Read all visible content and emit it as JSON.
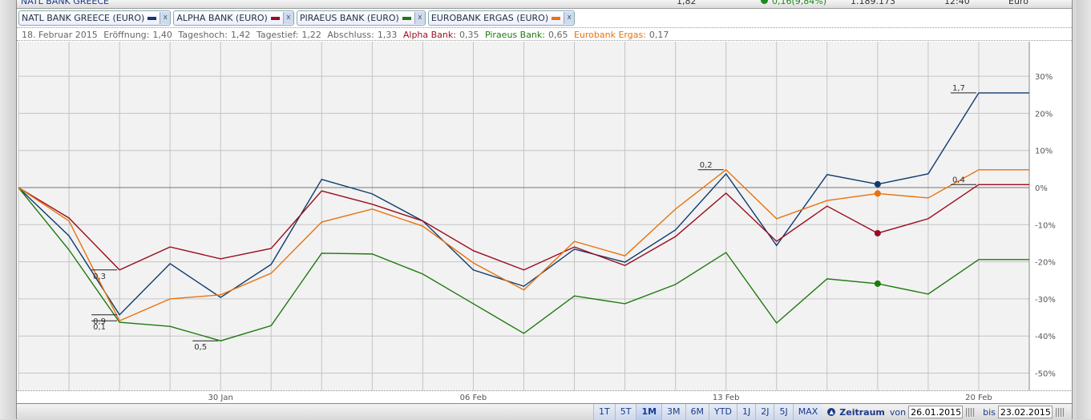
{
  "header": {
    "name": "NATL BANK GREECE",
    "price": "1,82",
    "change": "0,16(9,84%)",
    "volume": "1.189.173",
    "time": "12:40",
    "currency": "Euro",
    "change_color": "#1a8a1a"
  },
  "chips": [
    {
      "label": "NATL BANK GREECE (EURO)",
      "color": "#0d3b6e",
      "close": "x"
    },
    {
      "label": "ALPHA BANK (EURO)",
      "color": "#9b0d1e",
      "close": "x"
    },
    {
      "label": "PIRAEUS BANK (EURO)",
      "color": "#1f7a0f",
      "close": "x"
    },
    {
      "label": "EUROBANK ERGAS (EURO)",
      "color": "#e8720c",
      "close": "x"
    }
  ],
  "info": {
    "date": "18. Februar 2015",
    "open_label": "Eröffnung:",
    "open": "1,40",
    "high_label": "Tageshoch:",
    "high": "1,42",
    "low_label": "Tagestief:",
    "low": "1,22",
    "close_label": "Abschluss:",
    "close": "1,33",
    "alpha_label": "Alpha Bank:",
    "alpha": "0,35",
    "piraeus_label": "Piraeus Bank:",
    "piraeus": "0,65",
    "eurobank_label": "Eurobank Ergas:",
    "eurobank": "0,17"
  },
  "chart_data": {
    "type": "line",
    "x_ticks": [
      "30 Jan",
      "06 Feb",
      "13 Feb",
      "20 Feb"
    ],
    "x_tick_index": [
      4,
      9,
      14,
      19
    ],
    "x": [
      "26.01",
      "27.01",
      "28.01",
      "29.01",
      "30.01",
      "02.02",
      "03.02",
      "04.02",
      "05.02",
      "06.02",
      "09.02",
      "10.02",
      "11.02",
      "12.02",
      "13.02",
      "16.02",
      "17.02",
      "18.02",
      "19.02",
      "20.02",
      "23.02"
    ],
    "yticks": [
      "30%",
      "20%",
      "10%",
      "0%",
      "-10%",
      "-20%",
      "-30%",
      "-40%",
      "-50%"
    ],
    "yvals": [
      30,
      20,
      10,
      0,
      -10,
      -20,
      -30,
      -40,
      -50
    ],
    "ylim": [
      -55,
      38
    ],
    "grid": true,
    "series": [
      {
        "name": "NATL BANK GREECE (EURO)",
        "color": "#0d3b6e",
        "values": [
          0,
          -13,
          -34.3,
          -20.5,
          -29.6,
          -20.7,
          2.2,
          -1.7,
          -9,
          -22.2,
          -26.6,
          -16.6,
          -20.1,
          -11.4,
          3.7,
          -15.6,
          3.5,
          0.9,
          3.7,
          25.5,
          25.5
        ]
      },
      {
        "name": "ALPHA BANK (EURO)",
        "color": "#9b0d1e",
        "values": [
          0,
          -8.2,
          -22.2,
          -16,
          -19.2,
          -16.4,
          -0.9,
          -4.5,
          -9,
          -17,
          -22.2,
          -16,
          -21,
          -13.2,
          -1.5,
          -14.5,
          -5,
          -12.3,
          -8.4,
          0.8,
          0.8
        ]
      },
      {
        "name": "PIRAEUS BANK (EURO)",
        "color": "#1f7a0f",
        "values": [
          0,
          -16.8,
          -36.3,
          -37.4,
          -41.3,
          -37.2,
          -17.7,
          -17.9,
          -23.3,
          -31.3,
          -39.3,
          -29.2,
          -31.3,
          -26.1,
          -17.5,
          -36.5,
          -24.6,
          -25.9,
          -28.7,
          -19.4,
          -19.4
        ]
      },
      {
        "name": "EUROBANK ERGAS (EURO)",
        "color": "#e8720c",
        "values": [
          0,
          -9,
          -35.9,
          -30,
          -28.9,
          -23.1,
          -9.3,
          -5.8,
          -10.4,
          -20.3,
          -27.6,
          -14.5,
          -18.4,
          -5.8,
          4.8,
          -8.4,
          -3.5,
          -1.6,
          -2.8,
          4.8,
          4.8
        ]
      }
    ],
    "highlight_index": 17,
    "annotations": [
      {
        "text": "0,3",
        "index": 2,
        "value": -22.2,
        "pos": "below"
      },
      {
        "text": "0,9",
        "index": 2,
        "value": -34.3,
        "pos": "below"
      },
      {
        "text": "0,1",
        "index": 2,
        "value": -35.9,
        "pos": "below"
      },
      {
        "text": "0,5",
        "index": 4,
        "value": -41.3,
        "pos": "below"
      },
      {
        "text": "0,2",
        "index": 14,
        "value": 4.8,
        "pos": "above"
      },
      {
        "text": "1,7",
        "index": 19,
        "value": 25.5,
        "pos": "above"
      },
      {
        "text": "0,4",
        "index": 19,
        "value": 0.8,
        "pos": "above"
      }
    ]
  },
  "toolbar": {
    "ranges": [
      "1T",
      "5T",
      "1M",
      "3M",
      "6M",
      "YTD",
      "1J",
      "2J",
      "5J",
      "MAX"
    ],
    "active": "1M",
    "zeitraum": "Zeitraum",
    "von": "von",
    "from": "26.01.2015",
    "bis": "bis",
    "to": "23.02.2015"
  }
}
